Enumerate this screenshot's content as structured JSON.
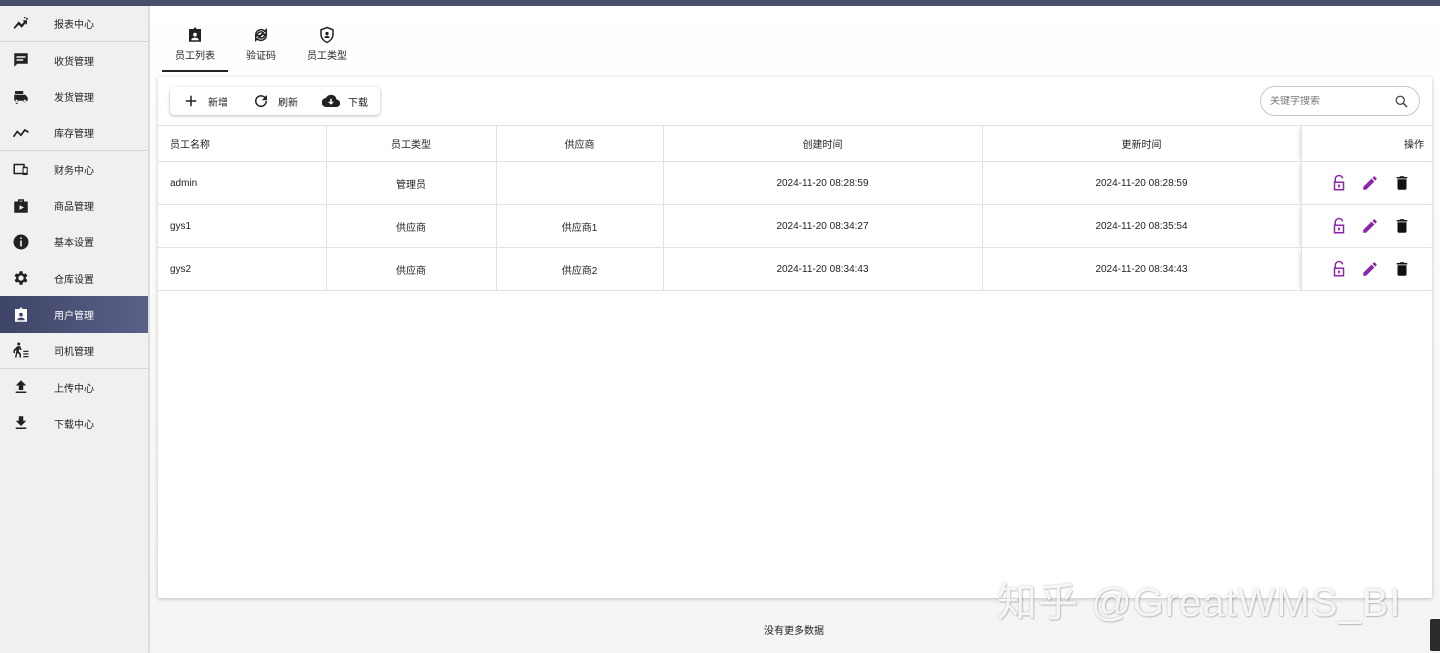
{
  "sidebar": {
    "items": [
      {
        "label": "报表中心",
        "icon": "chart-line-icon"
      },
      {
        "label": "收货管理",
        "icon": "message-icon"
      },
      {
        "label": "发货管理",
        "icon": "truck-icon"
      },
      {
        "label": "库存管理",
        "icon": "trending-icon"
      },
      {
        "label": "财务中心",
        "icon": "devices-icon"
      },
      {
        "label": "商品管理",
        "icon": "package-icon"
      },
      {
        "label": "基本设置",
        "icon": "info-icon"
      },
      {
        "label": "仓库设置",
        "icon": "gear-icon"
      },
      {
        "label": "用户管理",
        "icon": "user-card-icon",
        "active": true
      },
      {
        "label": "司机管理",
        "icon": "person-walking-icon"
      },
      {
        "label": "上传中心",
        "icon": "upload-icon"
      },
      {
        "label": "下载中心",
        "icon": "download-icon"
      }
    ]
  },
  "tabs": [
    {
      "label": "员工列表",
      "icon": "user-card-icon",
      "active": true
    },
    {
      "label": "验证码",
      "icon": "refresh-circle-icon"
    },
    {
      "label": "员工类型",
      "icon": "shield-user-icon"
    }
  ],
  "toolbar": {
    "add_label": "新增",
    "refresh_label": "刷新",
    "download_label": "下载"
  },
  "search": {
    "placeholder": "关键字搜索"
  },
  "table": {
    "columns": [
      "员工名称",
      "员工类型",
      "供应商",
      "创建时间",
      "更新时间",
      "操作"
    ],
    "rows": [
      {
        "name": "admin",
        "type": "管理员",
        "supplier": "",
        "created": "2024-11-20 08:28:59",
        "updated": "2024-11-20 08:28:59"
      },
      {
        "name": "gys1",
        "type": "供应商",
        "supplier": "供应商1",
        "created": "2024-11-20 08:34:27",
        "updated": "2024-11-20 08:35:54"
      },
      {
        "name": "gys2",
        "type": "供应商",
        "supplier": "供应商2",
        "created": "2024-11-20 08:34:43",
        "updated": "2024-11-20 08:34:43"
      }
    ]
  },
  "footer": {
    "message": "没有更多数据"
  },
  "watermark": "知乎 @GreatWMS_BI",
  "colors": {
    "accent": "#4a4f6e",
    "active_nav": "#4a5075",
    "lock": "#8e24aa",
    "edit": "#8e24aa",
    "delete": "#111111"
  }
}
